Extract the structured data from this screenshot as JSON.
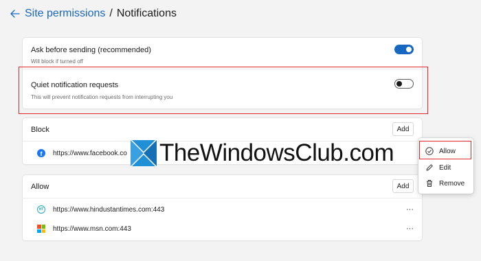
{
  "breadcrumb": {
    "parent": "Site permissions",
    "separator": "/",
    "current": "Notifications"
  },
  "settings": [
    {
      "title": "Ask before sending (recommended)",
      "subtitle": "Will block if turned off",
      "enabled": true
    },
    {
      "title": "Quiet notification requests",
      "subtitle": "This will prevent notification requests from interrupting you",
      "enabled": false
    }
  ],
  "block": {
    "title": "Block",
    "add_label": "Add",
    "sites": [
      {
        "url": "https://www.facebook.co",
        "icon": "facebook-icon"
      }
    ]
  },
  "allow": {
    "title": "Allow",
    "add_label": "Add",
    "sites": [
      {
        "url": "https://www.hindustantimes.com:443",
        "icon": "hindustantimes-icon",
        "more": "···"
      },
      {
        "url": "https://www.msn.com:443",
        "icon": "microsoft-icon",
        "more": "···"
      }
    ]
  },
  "context_menu": {
    "items": [
      {
        "label": "Allow",
        "icon": "checkmark-circle-icon"
      },
      {
        "label": "Edit",
        "icon": "pencil-icon"
      },
      {
        "label": "Remove",
        "icon": "trash-icon"
      }
    ]
  },
  "watermark": {
    "text": "TheWindowsClub.com"
  },
  "colors": {
    "accent": "#1867c0",
    "highlight": "#e0262b"
  }
}
